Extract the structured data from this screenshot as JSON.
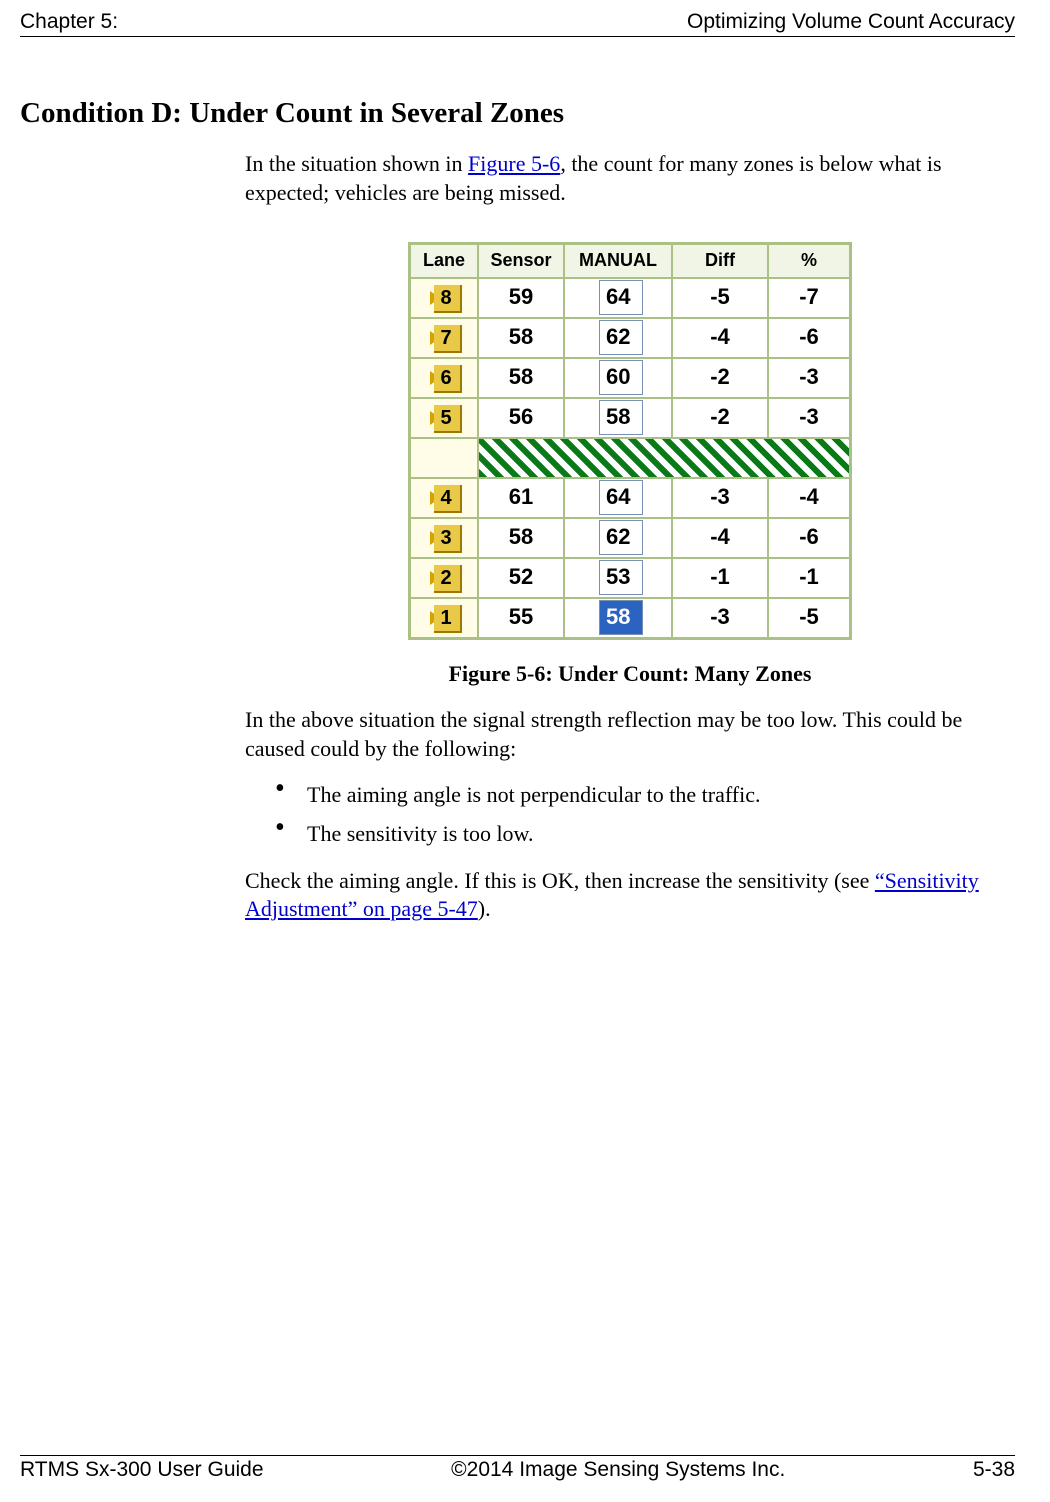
{
  "header": {
    "chapter": "Chapter 5:",
    "title": "Optimizing Volume Count Accuracy"
  },
  "section_title": "Condition D: Under Count in Several Zones",
  "intro": {
    "before_link": "In the situation shown in ",
    "link": "Figure 5-6",
    "after_link": ", the count for many zones is below what is expected; vehicles are being missed."
  },
  "chart_data": {
    "type": "table",
    "title": "Figure 5-6: Under Count: Many Zones",
    "columns": [
      "Lane",
      "Sensor",
      "MANUAL",
      "Diff",
      "%"
    ],
    "rows": [
      {
        "lane": "8",
        "sensor": "59",
        "manual": "64",
        "diff": "-5",
        "pct": "-7",
        "selected": false
      },
      {
        "lane": "7",
        "sensor": "58",
        "manual": "62",
        "diff": "-4",
        "pct": "-6",
        "selected": false
      },
      {
        "lane": "6",
        "sensor": "58",
        "manual": "60",
        "diff": "-2",
        "pct": "-3",
        "selected": false
      },
      {
        "lane": "5",
        "sensor": "56",
        "manual": "58",
        "diff": "-2",
        "pct": "-3",
        "selected": false
      },
      {
        "separator": true
      },
      {
        "lane": "4",
        "sensor": "61",
        "manual": "64",
        "diff": "-3",
        "pct": "-4",
        "selected": false
      },
      {
        "lane": "3",
        "sensor": "58",
        "manual": "62",
        "diff": "-4",
        "pct": "-6",
        "selected": false
      },
      {
        "lane": "2",
        "sensor": "52",
        "manual": "53",
        "diff": "-1",
        "pct": "-1",
        "selected": false
      },
      {
        "lane": "1",
        "sensor": "55",
        "manual": "58",
        "diff": "-3",
        "pct": "-5",
        "selected": true
      }
    ]
  },
  "para2": "In the above situation the signal strength reflection may be too low. This could be caused could by the following:",
  "bullets": [
    "The aiming angle is not perpendicular to the traffic.",
    "The sensitivity is too low."
  ],
  "para3": {
    "before_link": "Check the aiming angle. If this is OK, then increase the sensitivity (see ",
    "link": "“Sensitivity Adjustment” on page 5-47",
    "after_link": ")."
  },
  "footer": {
    "left": "RTMS Sx-300 User Guide",
    "center": "©2014 Image Sensing Systems Inc.",
    "right": "5-38"
  }
}
